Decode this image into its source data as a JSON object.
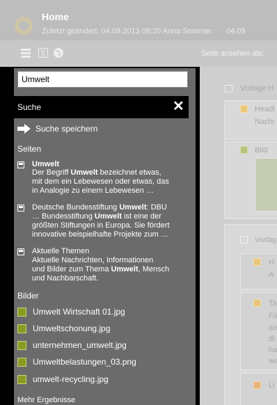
{
  "header": {
    "title": "Home",
    "subtitle": "Zuletzt geändert: 04.09.2013 08:20 Anna Sommer",
    "date_fragment": "04.09"
  },
  "toolbar": {
    "view_as_label": "Seite ansehen als:",
    "icons": [
      "menu-icon",
      "columns-icon",
      "globe-icon"
    ]
  },
  "search": {
    "value": "Umwelt",
    "header_label": "Suche",
    "close_symbol": "✕",
    "save_label": "Suche speichern"
  },
  "sections": {
    "pages": "Seiten",
    "images": "Bilder",
    "more": "Mehr Ergebnisse"
  },
  "page_results": [
    {
      "title": "Umwelt",
      "lines": [
        [
          "Der Begriff ",
          "Umwelt",
          " bezeichnet etwas,"
        ],
        [
          "mit dem ein Lebewesen oder etwas, das",
          "",
          ""
        ],
        [
          "in Analogie zu einem Lebewesen …",
          "",
          ""
        ]
      ]
    },
    {
      "title": "",
      "lines": [
        [
          "Deutsche Bundesstiftung ",
          "Umwelt",
          ": DBU"
        ],
        [
          "… Bundesstiftung ",
          "Umwelt",
          " ist eine der"
        ],
        [
          "größten Stiftungen in Europa. Sie fördert",
          "",
          ""
        ],
        [
          "innovative beispielhafte Projekte zum …",
          "",
          ""
        ]
      ]
    },
    {
      "title": "",
      "lines": [
        [
          "Aktuelle Themen",
          "",
          ""
        ],
        [
          "Aktuelle Nachrichten, Informationen",
          "",
          ""
        ],
        [
          "und Bilder zum Thema ",
          "Umwelt",
          ", Mensch"
        ],
        [
          "und Nachbarschaft.",
          "",
          ""
        ]
      ]
    }
  ],
  "image_results": [
    "Umwelt Wirtschaft 01.jpg",
    "Umweltschonung.jpg",
    "unternehmen_umwelt.jpg",
    "Umweltbelastungen_03.png",
    "umwelt-recycling.jpg"
  ],
  "background": {
    "labels": [
      "Vorlage H",
      "Headl",
      "Nachr",
      "Bild",
      "Vorlag",
      "H",
      "A",
      "Ta",
      "Fü",
      "an",
      "di",
      "ha",
      "we",
      "Li"
    ]
  },
  "colors": {
    "image_square": "#8a9a22",
    "panel": "#6b6b6b",
    "header_bar": "#000000"
  }
}
